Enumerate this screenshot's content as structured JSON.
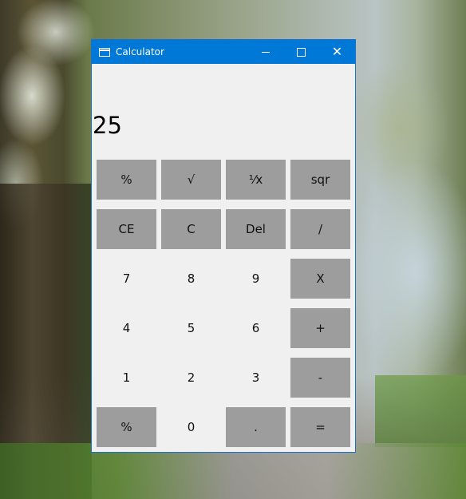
{
  "window": {
    "title": "Calculator",
    "accent_color": "#0078d7",
    "controls": {
      "minimize_icon": "minimize-icon",
      "maximize_icon": "maximize-icon",
      "close_glyph": "✕"
    }
  },
  "display": {
    "value": "25"
  },
  "keypad": {
    "rows": [
      [
        {
          "label": "%",
          "style": "gray"
        },
        {
          "label": "√",
          "style": "gray"
        },
        {
          "label": "⅟x",
          "style": "gray"
        },
        {
          "label": "sqr",
          "style": "gray"
        }
      ],
      [
        {
          "label": "CE",
          "style": "gray"
        },
        {
          "label": "C",
          "style": "gray"
        },
        {
          "label": "Del",
          "style": "gray"
        },
        {
          "label": "/",
          "style": "gray"
        }
      ],
      [
        {
          "label": "7",
          "style": "plain"
        },
        {
          "label": "8",
          "style": "plain"
        },
        {
          "label": "9",
          "style": "plain"
        },
        {
          "label": "X",
          "style": "gray"
        }
      ],
      [
        {
          "label": "4",
          "style": "plain"
        },
        {
          "label": "5",
          "style": "plain"
        },
        {
          "label": "6",
          "style": "plain"
        },
        {
          "label": "+",
          "style": "gray"
        }
      ],
      [
        {
          "label": "1",
          "style": "plain"
        },
        {
          "label": "2",
          "style": "plain"
        },
        {
          "label": "3",
          "style": "plain"
        },
        {
          "label": "-",
          "style": "gray"
        }
      ],
      [
        {
          "label": "%",
          "style": "gray"
        },
        {
          "label": "0",
          "style": "plain"
        },
        {
          "label": ".",
          "style": "gray"
        },
        {
          "label": "=",
          "style": "gray"
        }
      ]
    ],
    "button_gray": "#9d9d9d"
  }
}
